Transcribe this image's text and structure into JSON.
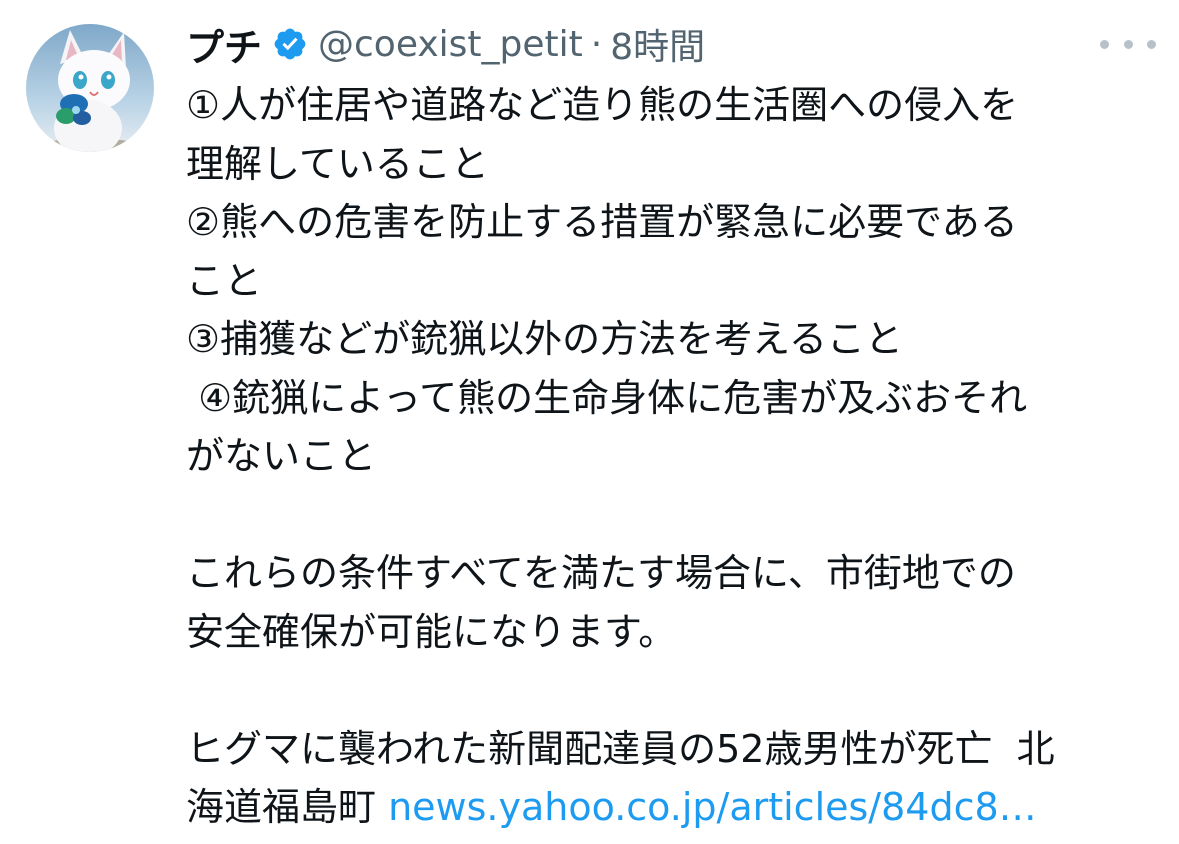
{
  "tweet": {
    "author": {
      "display_name": "プチ",
      "handle": "@coexist_petit",
      "verified": true,
      "avatar_icon": "white-cat-avatar"
    },
    "separator": "·",
    "timestamp": "8時間",
    "more_icon": "more-horizontal-icon",
    "body_lines": {
      "l1": "①人が住居や道路など造り熊の生活圏への侵入を",
      "l2": "理解していること",
      "l3": "②熊への危害を防止する措置が緊急に必要である",
      "l4": "こと",
      "l5": "③捕獲などが銃猟以外の方法を考えること",
      "l6": " ④銃猟によって熊の生命身体に危害が及ぶおそれ",
      "l7": "がないこと",
      "l8": "これらの条件すべてを満たす場合に、市街地での",
      "l9": "安全確保が可能になります。",
      "l10": "ヒグマに襲われた新聞配達員の52歳男性が死亡  北",
      "l11_prefix": "海道福島町 ",
      "l11_link": "news.yahoo.co.jp/articles/84dc8…"
    }
  },
  "colors": {
    "text_primary": "#0f1419",
    "text_secondary": "#536471",
    "link": "#1d9bf0",
    "verified_badge": "#1d9bf0"
  }
}
